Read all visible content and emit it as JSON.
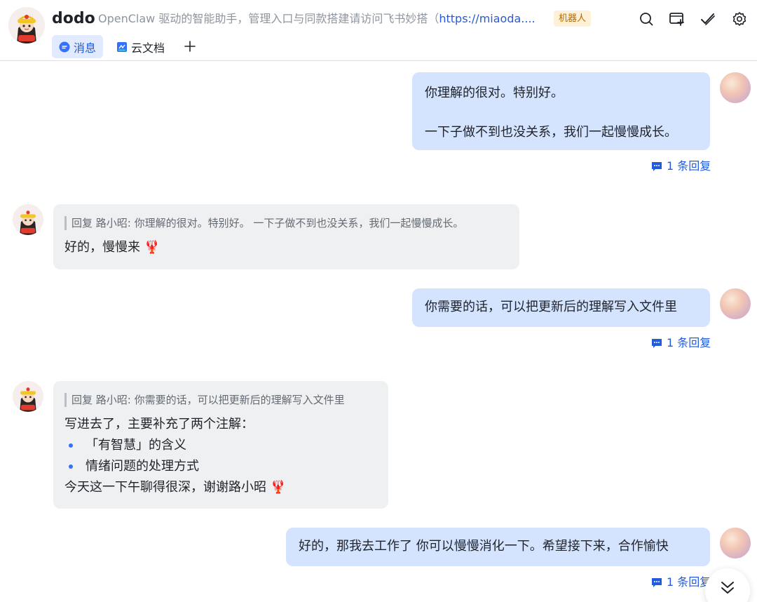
{
  "header": {
    "title": "dodo",
    "description": "OpenClaw 驱动的智能助手，管理入口与同款搭建请访问飞书妙搭（",
    "description_link": "https://miaoda....",
    "badge": "机器人",
    "tabs": [
      {
        "label": "消息",
        "icon": "chat-bubble-icon",
        "active": true
      },
      {
        "label": "云文档",
        "icon": "document-icon",
        "active": false
      }
    ],
    "actions": [
      "search-icon",
      "add-window-icon",
      "check-icon",
      "settings-icon"
    ]
  },
  "messages": [
    {
      "sender": "user",
      "lines": [
        "你理解的很对。特别好。",
        "",
        "一下子做不到也没关系，我们一起慢慢成长。"
      ],
      "reply_count": "1 条回复"
    },
    {
      "sender": "bot",
      "quote": "回复 路小昭: 你理解的很对。特别好。 一下子做不到也没关系，我们一起慢慢成长。",
      "text": "好的，慢慢来 🦞"
    },
    {
      "sender": "user",
      "lines": [
        "你需要的话，可以把更新后的理解写入文件里"
      ],
      "reply_count": "1 条回复"
    },
    {
      "sender": "bot",
      "quote": "回复 路小昭: 你需要的话，可以把更新后的理解写入文件里",
      "intro": "写进去了，主要补充了两个注解：",
      "bullets": [
        "「有智慧」的含义",
        "情绪问题的处理方式"
      ],
      "outro": "今天这一下午聊得很深，谢谢路小昭 🦞"
    },
    {
      "sender": "user",
      "lines": [
        "好的，那我去工作了 你可以慢慢消化一下。希望接下来，合作愉快"
      ],
      "reply_count": "1 条回复"
    }
  ],
  "colors": {
    "user_bubble": "#d4e3fe",
    "bot_bubble": "#eff0f1",
    "accent": "#245bdb",
    "badge_bg": "#fdf2d8",
    "badge_text": "#b26a00"
  }
}
